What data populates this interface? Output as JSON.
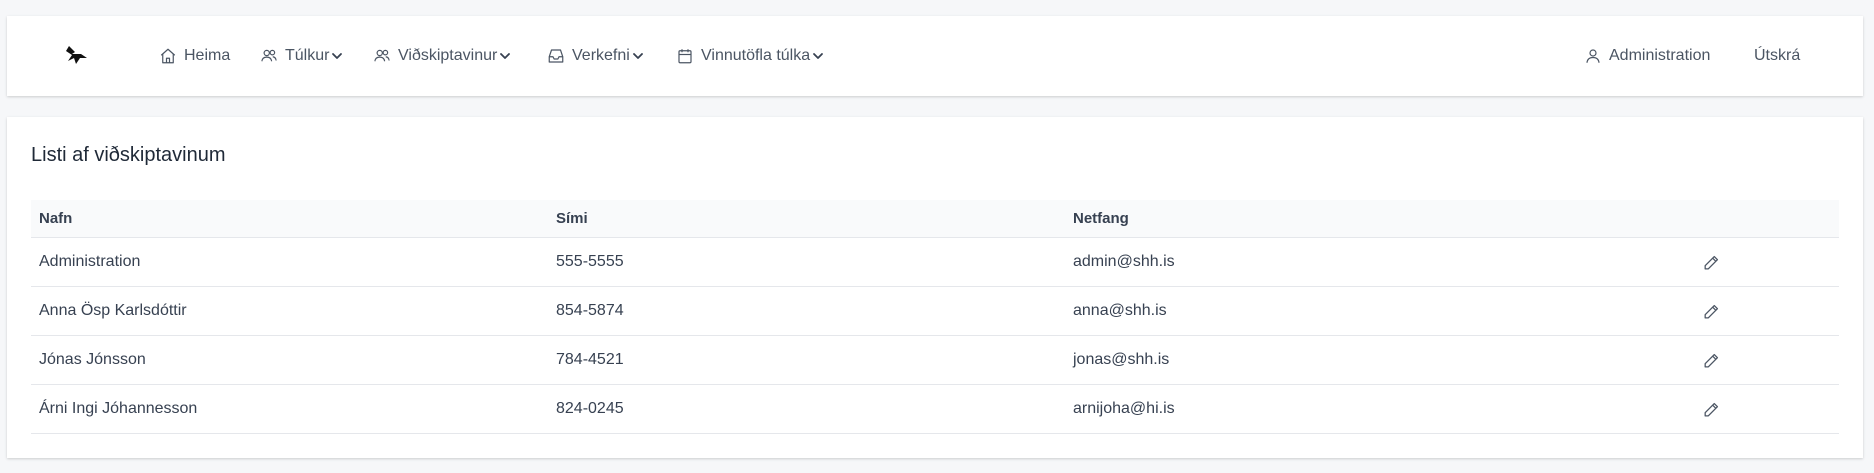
{
  "nav": {
    "home": "Heima",
    "interpreters": "Túlkur",
    "customer": "Viðskiptavinur",
    "tasks": "Verkefni",
    "schedule": "Vinnutöfla túlka",
    "user": "Administration",
    "logout": "Útskrá"
  },
  "page": {
    "title": "Listi af viðskiptavinum"
  },
  "table": {
    "columns": [
      "Nafn",
      "Sími",
      "Netfang"
    ],
    "rows": [
      {
        "name": "Administration",
        "phone": "555-5555",
        "email": "admin@shh.is"
      },
      {
        "name": "Anna Ösp Karlsdóttir",
        "phone": "854-5874",
        "email": "anna@shh.is"
      },
      {
        "name": "Jónas Jónsson",
        "phone": "784-4521",
        "email": "jonas@shh.is"
      },
      {
        "name": "Árni Ingi Jóhannesson",
        "phone": "824-0245",
        "email": "arnijoha@hi.is"
      }
    ]
  }
}
